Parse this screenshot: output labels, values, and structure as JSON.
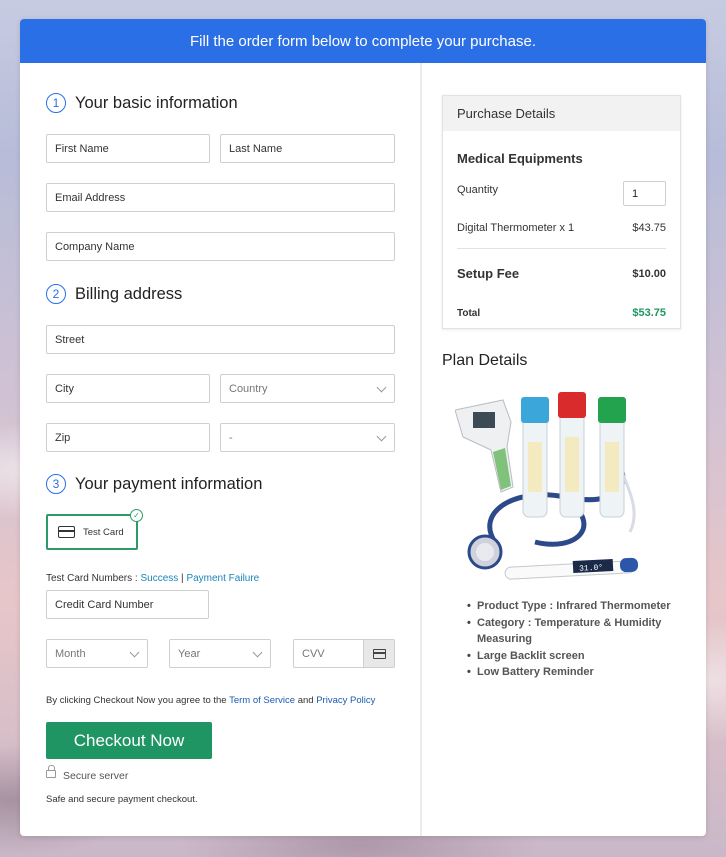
{
  "banner": {
    "text": "Fill the order form below to complete your purchase."
  },
  "sections": {
    "basic": {
      "num": "1",
      "title": "Your basic information"
    },
    "billing": {
      "num": "2",
      "title": "Billing address"
    },
    "payment": {
      "num": "3",
      "title": "Your payment information"
    }
  },
  "fields": {
    "first_name": "First Name",
    "last_name": "Last Name",
    "email": "Email Address",
    "company": "Company Name",
    "street": "Street",
    "city": "City",
    "country": "Country",
    "zip": "Zip",
    "state": "-",
    "card_number": "Credit Card Number",
    "month": "Month",
    "year": "Year",
    "cvv": "CVV"
  },
  "payment": {
    "test_card_label": "Test Card",
    "test_numbers_prefix": "Test Card Numbers : ",
    "success_link": "Success",
    "separator": " | ",
    "failure_link": "Payment Failure"
  },
  "terms": {
    "prefix": "By clicking Checkout Now you agree to the ",
    "tos_link": "Term of Service",
    "and": " and ",
    "privacy_link": "Privacy Policy"
  },
  "checkout": {
    "button": "Checkout Now",
    "secure": "Secure server",
    "note": "Safe and secure payment checkout."
  },
  "purchase": {
    "header": "Purchase Details",
    "product": "Medical Equipments",
    "quantity_label": "Quantity",
    "quantity_value": "1",
    "line_item": "Digital Thermometer x 1",
    "line_price": "$43.75",
    "setup_label": "Setup Fee",
    "setup_price": "$10.00",
    "total_label": "Total",
    "total_price": "$53.75",
    "total_color": "#1f9563"
  },
  "plan": {
    "title": "Plan Details",
    "features": [
      "Product Type : Infrared Thermometer",
      "Category : Temperature & Humidity Measuring",
      "Large Backlit screen",
      "Low Battery Reminder"
    ]
  },
  "image_display": {
    "thermometer_reading": "31.0°"
  },
  "colors": {
    "accent": "#2b6fe6",
    "checkout": "#1f9563",
    "link": "#1a86b8"
  }
}
